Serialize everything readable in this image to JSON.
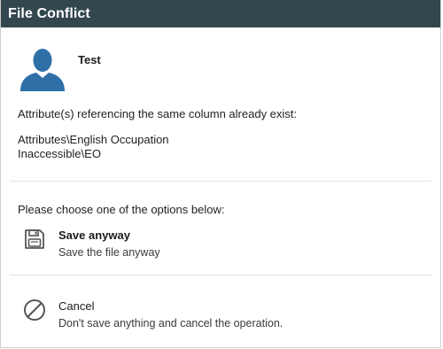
{
  "dialog": {
    "title": "File Conflict"
  },
  "user": {
    "name": "Test"
  },
  "message": "Attribute(s) referencing the same column already exist:",
  "attributes": [
    "Attributes\\English Occupation",
    "Inaccessible\\EO"
  ],
  "prompt": "Please choose one of the options below:",
  "options": [
    {
      "title": "Save anyway",
      "description": "Save the file anyway",
      "icon": "floppy-disk-icon"
    },
    {
      "title": "Cancel",
      "description": "Don't save anything and cancel the operation.",
      "icon": "prohibited-icon"
    }
  ],
  "colors": {
    "titlebar": "#33474f",
    "avatar": "#2f6fa8",
    "icon_gray": "#555555"
  }
}
